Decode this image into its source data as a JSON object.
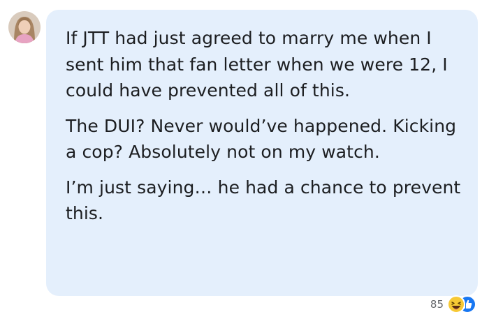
{
  "comment": {
    "paragraphs": [
      "If JTT had just agreed to marry me when I sent him that fan letter when we were 12, I could have prevented all of this.",
      "The DUI? Never would’ve happened. Kicking a cop? Absolutely not on my watch.",
      "I’m just saying… he had a chance to prevent this."
    ],
    "bubble_color": "#e4effc",
    "text_color": "#1c1e21"
  },
  "reactions": {
    "count": "85",
    "icons": [
      "haha-icon",
      "like-icon"
    ],
    "count_color": "#65676b"
  },
  "avatar": {
    "icon": "profile-photo"
  }
}
